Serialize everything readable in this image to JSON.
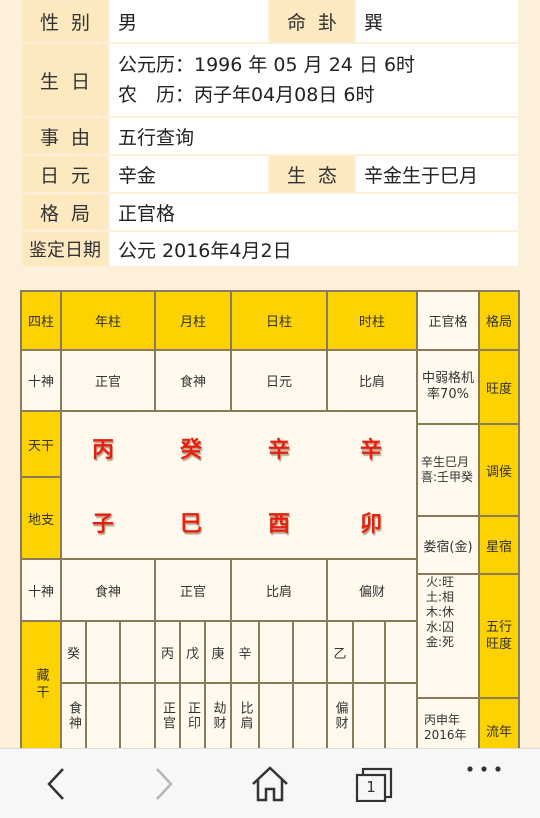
{
  "info": {
    "gender_label": "性别",
    "gender_value": "男",
    "minggua_label": "命卦",
    "minggua_value": "巽",
    "birthday_label": "生日",
    "solar_line": "公元历：1996 年 05 月 24 日 6时",
    "lunar_line": "农　历：丙子年04月08日 6时",
    "reason_label": "事由",
    "reason_value": "五行查询",
    "riyuan_label": "日元",
    "riyuan_value": "辛金",
    "shengtai_label": "生态",
    "shengtai_value": "辛金生于巳月",
    "geju_label": "格局",
    "geju_value": "正官格",
    "date_label": "鉴定日期",
    "date_value": "公元 2016年4月2日"
  },
  "chart": {
    "header": [
      "四柱",
      "年柱",
      "月柱",
      "日柱",
      "时柱"
    ],
    "shishen_label": "十神",
    "shishen_top": [
      "正官",
      "食神",
      "日元",
      "比肩"
    ],
    "tiangan_label": "天干",
    "tiangan": [
      "丙",
      "癸",
      "辛",
      "辛"
    ],
    "dizhi_label": "地支",
    "dizhi": [
      "子",
      "巳",
      "酉",
      "卯"
    ],
    "shishen_bottom": [
      "食神",
      "正官",
      "比肩",
      "偏财"
    ],
    "canggan_label": "藏干",
    "canggan_chars": [
      "癸",
      "丙",
      "戊",
      "庚",
      "辛",
      "乙"
    ],
    "canggan_gods": [
      "食神",
      "正官",
      "正印",
      "劫财",
      "比肩",
      "偏财"
    ],
    "side": {
      "geju_val": "正官格",
      "geju_lab": "格局",
      "wangdu_val": "中弱格机率70%",
      "wangdu_lab": "旺度",
      "tiaohou_val": "辛生巳月喜:壬甲癸",
      "tiaohou_lab": "调侯",
      "xingsu_val": "娄宿(金)",
      "xingsu_lab": "星宿",
      "wx1": "火:旺",
      "wx2": "土:相",
      "wx3": "木:休",
      "wx4": "水:囚",
      "wx5": "金:死",
      "wx_lab": "五行旺度",
      "liunian_val": "丙申年2016年",
      "liunian_lab": "流年"
    }
  },
  "nav": {
    "tab_count": "1",
    "icons": [
      "back-icon",
      "forward-icon",
      "home-icon",
      "tabs-icon",
      "more-icon"
    ]
  }
}
